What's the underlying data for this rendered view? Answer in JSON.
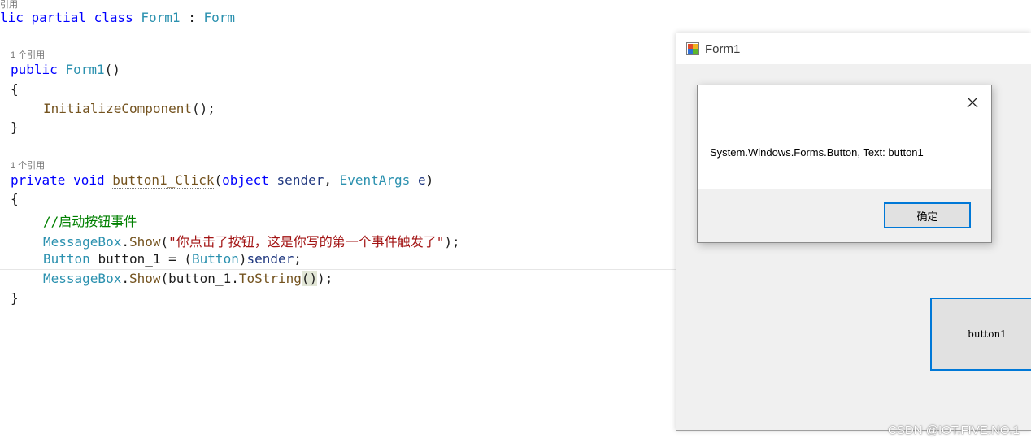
{
  "editor": {
    "lens_top": "引用",
    "lens_ref": "1 个引用",
    "lines": {
      "class_decl": [
        "lic partial class ",
        "Form1",
        " : ",
        "Form"
      ],
      "ctor": [
        "public ",
        "Form1",
        "()"
      ],
      "open_brace": "{",
      "close_brace": "}",
      "init_call": [
        "InitializeComponent",
        "();"
      ],
      "handler_sig": [
        "private void ",
        "button1_Click",
        "(",
        "object",
        " ",
        "sender",
        ", ",
        "EventArgs",
        " ",
        "e",
        ")"
      ],
      "comment": "//启动按钮事件",
      "msg_call1": [
        "MessageBox",
        ".",
        "Show",
        "(",
        "\"你点击了按钮，这是你写的第一个事件触发了\"",
        ");"
      ],
      "cast_line": [
        "Button",
        " ",
        "button_1",
        " = (",
        "Button",
        ")",
        "sender",
        ";"
      ],
      "msg_call2": [
        "MessageBox",
        ".",
        "Show",
        "(",
        "button_1",
        ".",
        "ToString",
        "()",
        ");"
      ]
    }
  },
  "form": {
    "title": "Form1",
    "button_label": "button1"
  },
  "messagebox": {
    "text": "System.Windows.Forms.Button, Text: button1",
    "ok_label": "确定"
  },
  "watermark": "CSDN @IOT.FIVE.NO.1"
}
